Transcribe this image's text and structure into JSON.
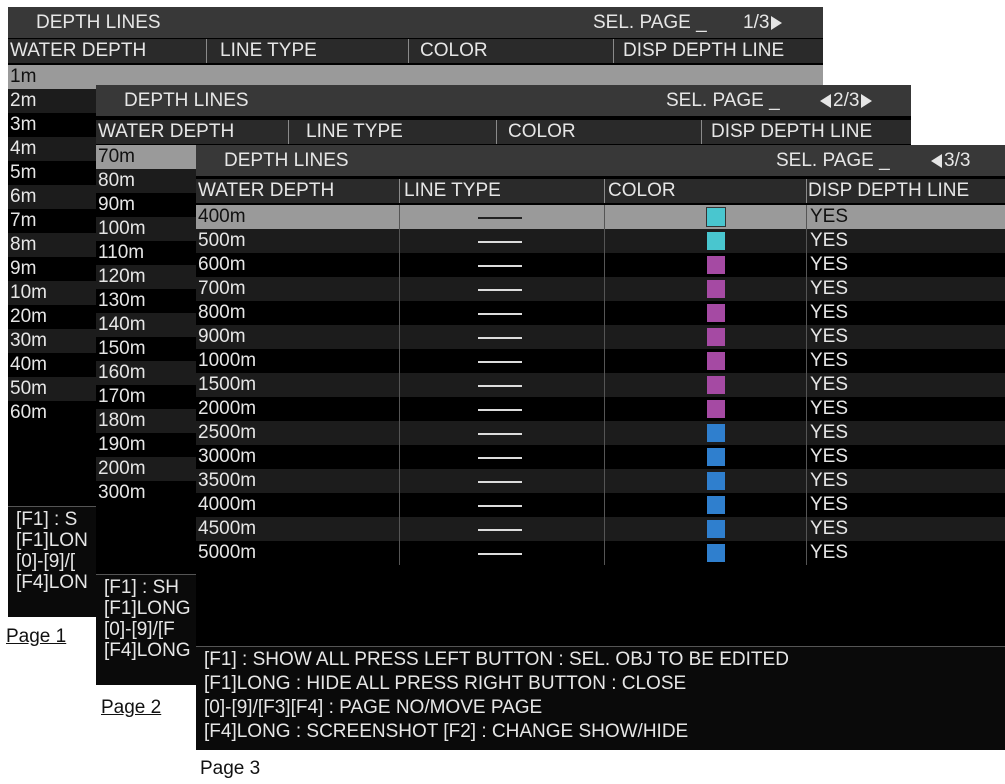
{
  "page1": {
    "title": "DEPTH LINES",
    "sel_page": "SEL. PAGE _",
    "page_no": "1/3",
    "headers": [
      "WATER DEPTH",
      "LINE TYPE",
      "COLOR",
      "DISP DEPTH LINE"
    ],
    "depths": [
      "1m",
      "2m",
      "3m",
      "4m",
      "5m",
      "6m",
      "7m",
      "8m",
      "9m",
      "10m",
      "20m",
      "30m",
      "40m",
      "50m",
      "60m"
    ],
    "footer": [
      "[F1] : S",
      "[F1]LON",
      "[0]-[9]/[",
      "[F4]LON"
    ],
    "caption": "Page 1"
  },
  "page2": {
    "title": "DEPTH LINES",
    "sel_page": "SEL. PAGE _",
    "page_no": "2/3",
    "headers": [
      "WATER DEPTH",
      "LINE TYPE",
      "COLOR",
      "DISP DEPTH LINE"
    ],
    "depths": [
      "70m",
      "80m",
      "90m",
      "100m",
      "110m",
      "120m",
      "130m",
      "140m",
      "150m",
      "160m",
      "170m",
      "180m",
      "190m",
      "200m",
      "300m"
    ],
    "footer": [
      "[F1] : SH",
      "[F1]LONG",
      "[0]-[9]/[F",
      "[F4]LONG"
    ],
    "caption": "Page 2"
  },
  "page3": {
    "title": "DEPTH LINES",
    "sel_page": "SEL. PAGE _",
    "page_no": "3/3",
    "headers": [
      "WATER DEPTH",
      "LINE TYPE",
      "COLOR",
      "DISP DEPTH LINE"
    ],
    "rows": [
      {
        "depth": "400m",
        "color": "#49c6cf",
        "disp": "YES"
      },
      {
        "depth": "500m",
        "color": "#49c6cf",
        "disp": "YES"
      },
      {
        "depth": "600m",
        "color": "#a54aa3",
        "disp": "YES"
      },
      {
        "depth": "700m",
        "color": "#a54aa3",
        "disp": "YES"
      },
      {
        "depth": "800m",
        "color": "#a54aa3",
        "disp": "YES"
      },
      {
        "depth": "900m",
        "color": "#a54aa3",
        "disp": "YES"
      },
      {
        "depth": "1000m",
        "color": "#a54aa3",
        "disp": "YES"
      },
      {
        "depth": "1500m",
        "color": "#a54aa3",
        "disp": "YES"
      },
      {
        "depth": "2000m",
        "color": "#a54aa3",
        "disp": "YES"
      },
      {
        "depth": "2500m",
        "color": "#2f7fce",
        "disp": "YES"
      },
      {
        "depth": "3000m",
        "color": "#2f7fce",
        "disp": "YES"
      },
      {
        "depth": "3500m",
        "color": "#2f7fce",
        "disp": "YES"
      },
      {
        "depth": "4000m",
        "color": "#2f7fce",
        "disp": "YES"
      },
      {
        "depth": "4500m",
        "color": "#2f7fce",
        "disp": "YES"
      },
      {
        "depth": "5000m",
        "color": "#2f7fce",
        "disp": "YES"
      }
    ],
    "footer": [
      "[F1] : SHOW ALL   PRESS LEFT BUTTON : SEL. OBJ TO BE EDITED",
      "[F1]LONG : HIDE ALL   PRESS RIGHT BUTTON : CLOSE",
      "[0]-[9]/[F3][F4] : PAGE NO/MOVE PAGE",
      "[F4]LONG : SCREENSHOT   [F2] : CHANGE SHOW/HIDE"
    ],
    "caption": "Page 3"
  }
}
